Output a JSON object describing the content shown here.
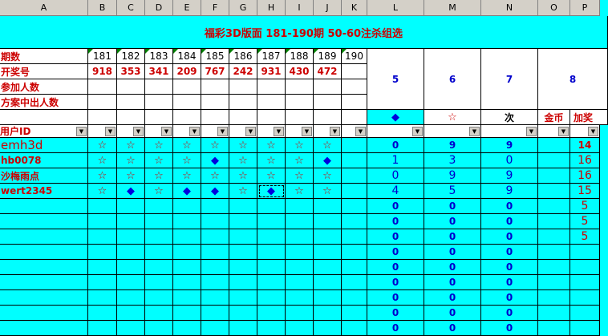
{
  "columns": [
    "A",
    "B",
    "C",
    "D",
    "E",
    "F",
    "G",
    "H",
    "I",
    "J",
    "K",
    "L",
    "M",
    "N",
    "O",
    "P"
  ],
  "title": "福彩3D版面  181-190期  50-60注杀组选",
  "row_labels": {
    "period": "期数",
    "draw": "开奖号",
    "participants": "参加人数",
    "plan_hits": "方案中出人数",
    "user_id": "用户ID"
  },
  "periods": [
    "181",
    "182",
    "183",
    "184",
    "185",
    "186",
    "187",
    "188",
    "189",
    "190"
  ],
  "draws": [
    "918",
    "353",
    "341",
    "209",
    "767",
    "242",
    "931",
    "430",
    "472",
    ""
  ],
  "summary_cols": {
    "L": "5",
    "M": "6",
    "N": "7",
    "P": "8"
  },
  "legend": {
    "L": "◆",
    "M": "☆",
    "N": "次",
    "O": "金币",
    "P": "加奖"
  },
  "users": [
    {
      "id": "emh3d",
      "marks": [
        "star",
        "star",
        "star",
        "star",
        "star",
        "star",
        "star",
        "star",
        "star"
      ],
      "L": "0",
      "M": "9",
      "N": "9",
      "P": "14"
    },
    {
      "id": "hb0078",
      "marks": [
        "star",
        "star",
        "star",
        "star",
        "dia",
        "star",
        "star",
        "star",
        "dia"
      ],
      "L": "1",
      "M": "3",
      "N": "0",
      "P": "16"
    },
    {
      "id": "沙梅雨点",
      "marks": [
        "star",
        "star",
        "star",
        "star",
        "star",
        "star",
        "star",
        "star",
        "star"
      ],
      "L": "0",
      "M": "9",
      "N": "9",
      "P": "16"
    },
    {
      "id": "wert2345",
      "marks": [
        "star",
        "dia",
        "star",
        "dia",
        "dia",
        "star",
        "dia",
        "star",
        "star"
      ],
      "L": "4",
      "M": "5",
      "N": "9",
      "P": "15"
    }
  ],
  "empty_rows": [
    {
      "L": "0",
      "M": "0",
      "N": "0",
      "P": "5"
    },
    {
      "L": "0",
      "M": "0",
      "N": "0",
      "P": "5"
    },
    {
      "L": "0",
      "M": "0",
      "N": "0",
      "P": "5"
    },
    {
      "L": "0",
      "M": "0",
      "N": "0",
      "P": ""
    },
    {
      "L": "0",
      "M": "0",
      "N": "0",
      "P": ""
    },
    {
      "L": "0",
      "M": "0",
      "N": "0",
      "P": ""
    },
    {
      "L": "0",
      "M": "0",
      "N": "0",
      "P": ""
    },
    {
      "L": "0",
      "M": "0",
      "N": "0",
      "P": ""
    },
    {
      "L": "0",
      "M": "0",
      "N": "0",
      "P": ""
    }
  ],
  "colors": {
    "background": "#00ffff",
    "red": "#cc0000",
    "blue": "#0000cc"
  }
}
